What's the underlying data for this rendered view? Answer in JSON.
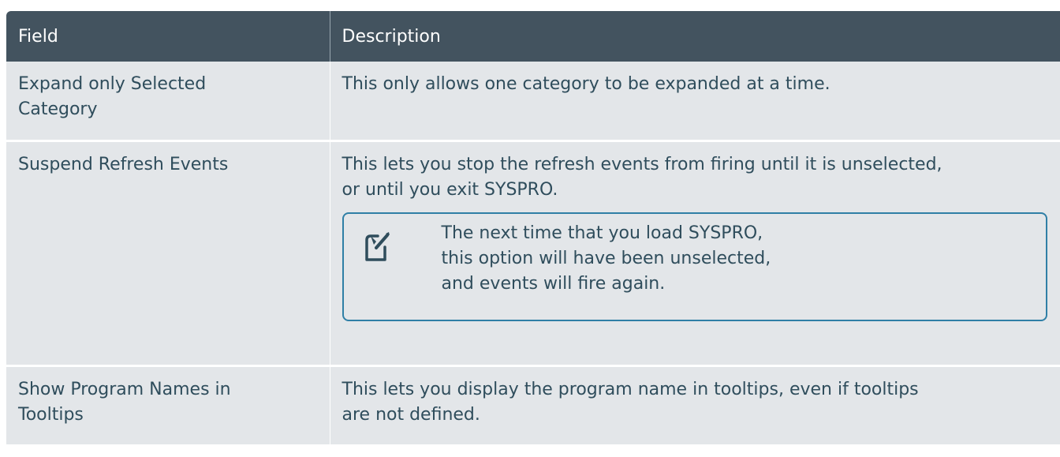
{
  "table": {
    "headers": {
      "field": "Field",
      "description": "Description"
    },
    "rows": [
      {
        "field": "Expand only Selected\nCategory",
        "description": "This only allows one category to be expanded at a time."
      },
      {
        "field": "Suspend Refresh Events",
        "description": "This lets you stop the refresh events from firing until it is unselected,\nor until you exit SYSPRO.",
        "note": "The next time that you load SYSPRO, this option will have been unselected, and events will fire again."
      },
      {
        "field": "Show Program Names in\nTooltips",
        "description": "This lets you display the program name in tooltips, even if tooltips\nare not defined."
      }
    ]
  },
  "icons": {
    "note": "note-edit-icon"
  },
  "colors": {
    "header_bg": "#43535f",
    "row_bg": "#e3e6e9",
    "text": "#2f4d5c",
    "note_border": "#2f7fa6"
  }
}
